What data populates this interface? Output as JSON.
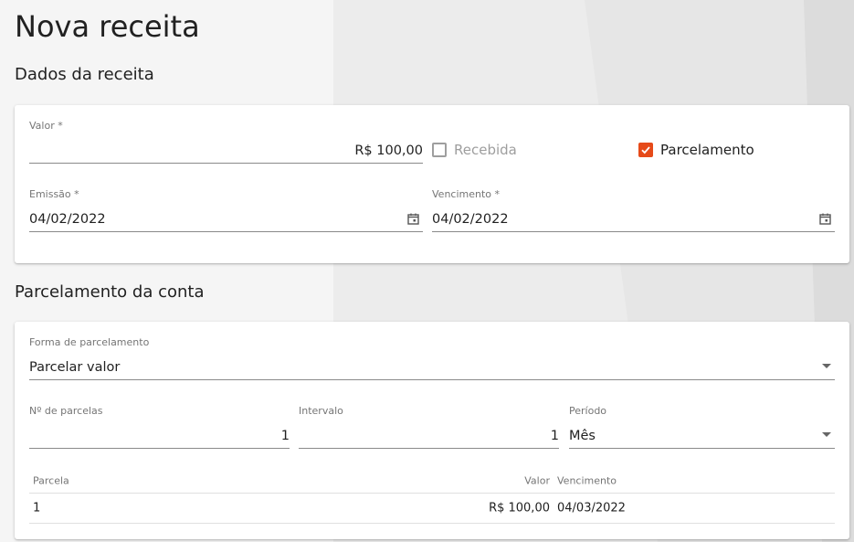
{
  "page": {
    "title": "Nova receita"
  },
  "sections": {
    "dados": "Dados da receita",
    "parcelamento": "Parcelamento da conta"
  },
  "dados": {
    "valor_label": "Valor *",
    "valor": "R$ 100,00",
    "recebida_label": "Recebida",
    "recebida_checked": false,
    "parcelamento_label": "Parcelamento",
    "parcelamento_checked": true,
    "emissao_label": "Emissão *",
    "emissao": "04/02/2022",
    "vencimento_label": "Vencimento *",
    "vencimento": "04/02/2022",
    "calendar_icon": "calendar-icon"
  },
  "parcelamento": {
    "forma_label": "Forma de parcelamento",
    "forma": "Parcelar valor",
    "parcelas_label": "Nº de parcelas",
    "parcelas": "1",
    "intervalo_label": "Intervalo",
    "intervalo": "1",
    "periodo_label": "Período",
    "periodo": "Mês",
    "dropdown_icon": "chevron-down-icon"
  },
  "table": {
    "columns": [
      "Parcela",
      "Valor",
      "Vencimento"
    ],
    "rows": [
      {
        "parcela": "1",
        "valor": "R$ 100,00",
        "vencimento": "04/03/2022"
      }
    ]
  },
  "colors": {
    "accent": "#e64a19",
    "checkbox_unchecked": "#9e9e9e"
  }
}
